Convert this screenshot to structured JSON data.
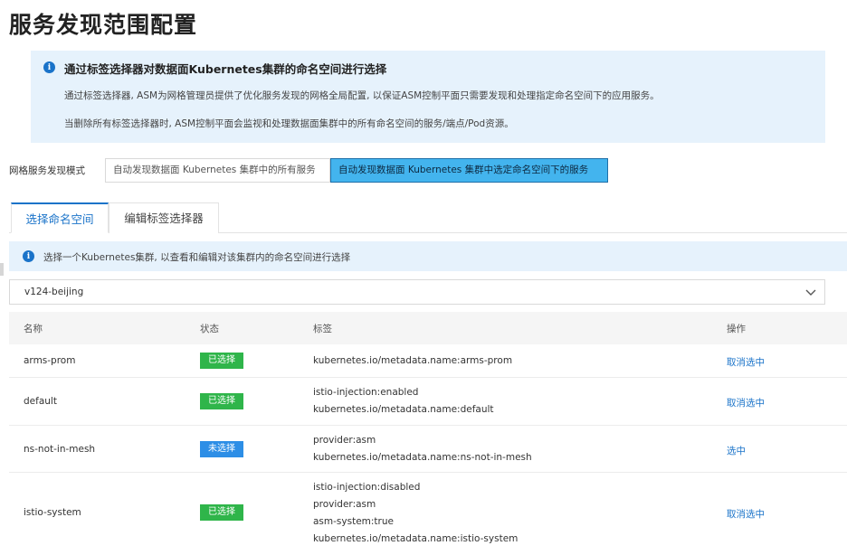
{
  "page": {
    "title": "服务发现范围配置"
  },
  "info": {
    "title": "通过标签选择器对数据面Kubernetes集群的命名空间进行选择",
    "line1": "通过标签选择器, ASM为网格管理员提供了优化服务发现的网格全局配置, 以保证ASM控制平面只需要发现和处理指定命名空间下的应用服务。",
    "line2": "当删除所有标签选择器时, ASM控制平面会监视和处理数据面集群中的所有命名空间的服务/端点/Pod资源。",
    "icon_glyph": "i"
  },
  "mode": {
    "label": "网格服务发现模式",
    "option1": "自动发现数据面 Kubernetes 集群中的所有服务",
    "option2": "自动发现数据面 Kubernetes 集群中选定命名空间下的服务"
  },
  "tabs": [
    {
      "label": "选择命名空间"
    },
    {
      "label": "编辑标签选择器"
    }
  ],
  "notice": {
    "text": "选择一个Kubernetes集群, 以查看和编辑对该集群内的命名空间进行选择"
  },
  "cluster_select": {
    "value": "v124-beijing"
  },
  "table": {
    "headers": {
      "name": "名称",
      "status": "状态",
      "labels": "标签",
      "action": "操作"
    },
    "rows": [
      {
        "name": "arms-prom",
        "status": "已选择",
        "labels": [
          "kubernetes.io/metadata.name:arms-prom"
        ],
        "action": "取消选中"
      },
      {
        "name": "default",
        "status": "已选择",
        "labels": [
          "istio-injection:enabled",
          "kubernetes.io/metadata.name:default"
        ],
        "action": "取消选中"
      },
      {
        "name": "ns-not-in-mesh",
        "status": "未选择",
        "labels": [
          "provider:asm",
          "kubernetes.io/metadata.name:ns-not-in-mesh"
        ],
        "action": "选中"
      },
      {
        "name": "istio-system",
        "status": "已选择",
        "labels": [
          "istio-injection:disabled",
          "provider:asm",
          "asm-system:true",
          "kubernetes.io/metadata.name:istio-system"
        ],
        "action": "取消选中"
      }
    ]
  },
  "colors": {
    "accent": "#1a73c9",
    "selected_badge": "#2fb54a",
    "unselected_badge": "#2d8ee6",
    "info_bg": "#e6f2fc",
    "active_mode": "#43b4ee"
  }
}
